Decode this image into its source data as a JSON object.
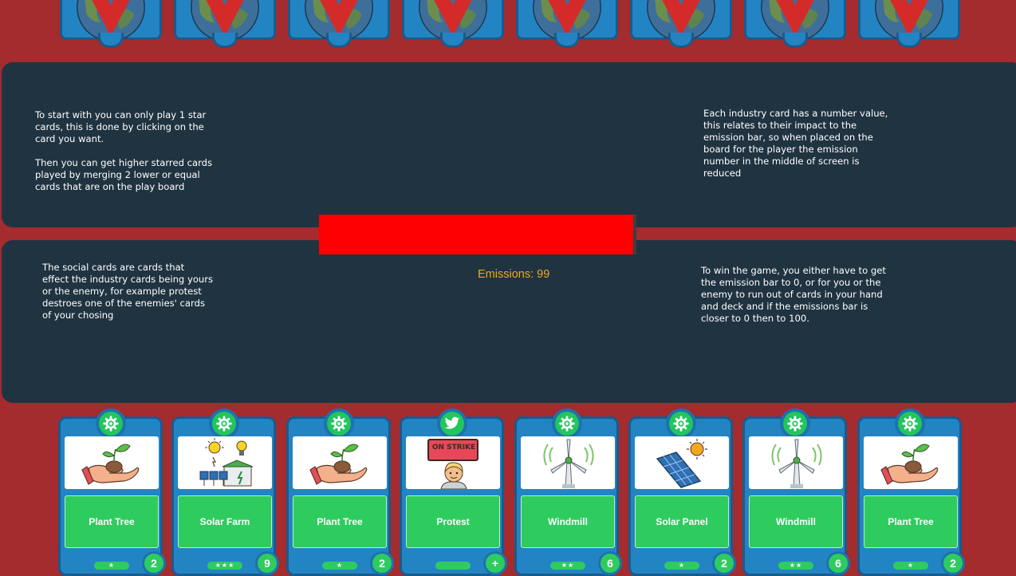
{
  "colors": {
    "background": "#a42b2e",
    "board": "#203341",
    "card_blue": "#2384c4",
    "card_green": "#2ecc5f",
    "emission_bar": "#ff0000",
    "emission_text": "#f0a81c"
  },
  "enemy_hand": {
    "card_count": 8,
    "icon": "globe-crossed-icon"
  },
  "top_board": {
    "left_text": "To start with you can only play 1 star cards, this is done by clicking on the card you want.\n\nThen you can get higher starred cards played by merging 2 lower or equal cards that are on the play board",
    "right_text": "Each industry card has a number value, this relates to their impact to the emission bar, so when placed on the board for the player the emission number in the middle of screen is reduced"
  },
  "bottom_board": {
    "left_text": "The social cards are cards that effect the industry cards being yours or the enemy, for example protest destroes one of the enemies' cards of your chosing",
    "right_text": "To win the game, you either have to get the emission bar to 0, or for you or the enemy to run out of cards in your hand and deck and if the emissions bar is closer to 0 then to 100."
  },
  "emissions": {
    "label": "Emissions: 99",
    "value": 99,
    "max": 100
  },
  "player_hand": [
    {
      "name": "Plant Tree",
      "stars": "★",
      "value": "2",
      "type_icon": "gear-icon",
      "art": "plant-hand-icon"
    },
    {
      "name": "Solar Farm",
      "stars": "★★★",
      "value": "9",
      "type_icon": "gear-icon",
      "art": "solar-farm-icon"
    },
    {
      "name": "Plant Tree",
      "stars": "★",
      "value": "2",
      "type_icon": "gear-icon",
      "art": "plant-hand-icon"
    },
    {
      "name": "Protest",
      "stars": "",
      "value": "+",
      "type_icon": "twitter-bird-icon",
      "art": "on-strike-icon",
      "sign_text": "ON STRIKE"
    },
    {
      "name": "Windmill",
      "stars": "★★",
      "value": "6",
      "type_icon": "gear-icon",
      "art": "windmill-icon"
    },
    {
      "name": "Solar Panel",
      "stars": "★",
      "value": "2",
      "type_icon": "gear-icon",
      "art": "solar-panel-icon"
    },
    {
      "name": "Windmill",
      "stars": "★★",
      "value": "6",
      "type_icon": "gear-icon",
      "art": "windmill-icon"
    },
    {
      "name": "Plant Tree",
      "stars": "★",
      "value": "2",
      "type_icon": "gear-icon",
      "art": "plant-hand-icon"
    }
  ]
}
